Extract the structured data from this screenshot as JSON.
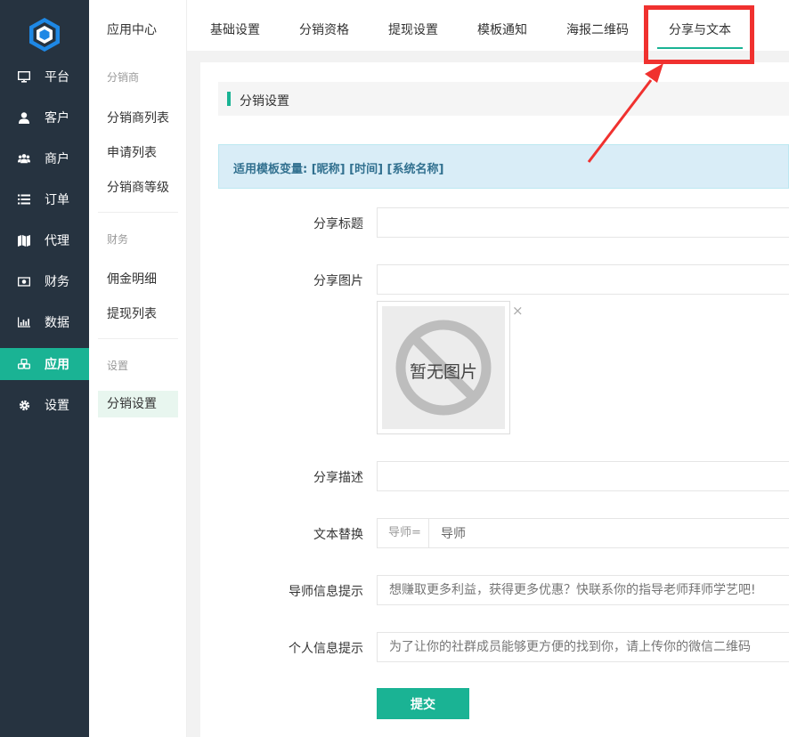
{
  "nav": {
    "items": [
      {
        "label": "平台",
        "icon": "monitor-icon"
      },
      {
        "label": "客户",
        "icon": "user-icon"
      },
      {
        "label": "商户",
        "icon": "users-icon"
      },
      {
        "label": "订单",
        "icon": "list-icon"
      },
      {
        "label": "代理",
        "icon": "map-icon"
      },
      {
        "label": "财务",
        "icon": "money-icon"
      },
      {
        "label": "数据",
        "icon": "bar-chart-icon"
      },
      {
        "label": "应用",
        "icon": "cubes-icon",
        "active": true
      },
      {
        "label": "设置",
        "icon": "gear-icon"
      }
    ],
    "active_color": "#1ab394",
    "background": "#263340"
  },
  "sub": {
    "title": "应用中心",
    "groups": [
      {
        "heading": "分销商",
        "items": [
          "分销商列表",
          "申请列表",
          "分销商等级"
        ]
      },
      {
        "heading": "财务",
        "items": [
          "佣金明细",
          "提现列表"
        ]
      },
      {
        "heading": "设置",
        "items": [
          "分销设置"
        ]
      }
    ],
    "active_item": "分销设置"
  },
  "tabs": [
    "基础设置",
    "分销资格",
    "提现设置",
    "模板通知",
    "海报二维码",
    "分享与文本"
  ],
  "active_tab": "分享与文本",
  "section": {
    "title": "分销设置"
  },
  "alert": {
    "text": "适用模板变量: [昵称] [时间] [系统名称]"
  },
  "form": {
    "share_title": {
      "label": "分享标题",
      "value": ""
    },
    "share_image": {
      "label": "分享图片",
      "value": "",
      "placeholder_text": "暂无图片",
      "remove": "×"
    },
    "share_desc": {
      "label": "分享描述",
      "value": ""
    },
    "text_replace": {
      "label": "文本替换",
      "addon": "导师=",
      "value": "导师"
    },
    "mentor_tip": {
      "label": "导师信息提示",
      "placeholder": "想赚取更多利益，获得更多优惠？快联系你的指导老师拜师学艺吧!"
    },
    "personal_tip": {
      "label": "个人信息提示",
      "placeholder": "为了让你的社群成员能够更方便的找到你，请上传你的微信二维码"
    },
    "submit": "提交"
  },
  "highlight_color": "#f0312f"
}
